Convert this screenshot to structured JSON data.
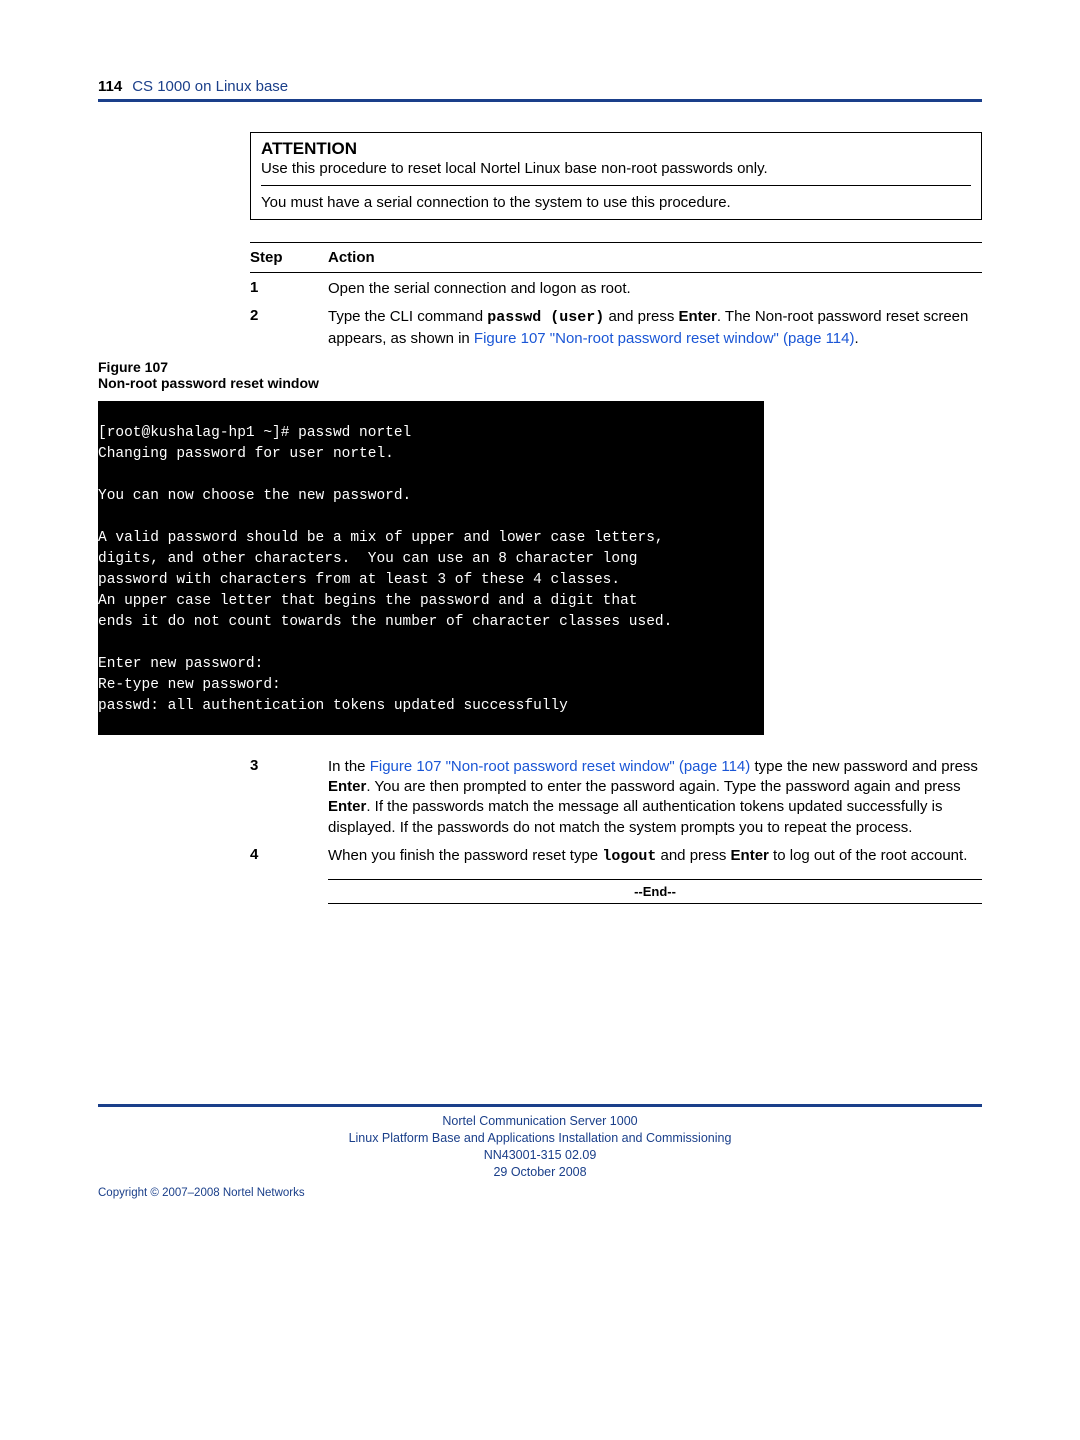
{
  "header": {
    "page_number": "114",
    "section": "CS 1000 on Linux base"
  },
  "attention": {
    "heading": "ATTENTION",
    "line1": "Use this procedure to reset local Nortel Linux base non-root passwords only.",
    "line2": "You must have a serial connection to the system to use this procedure."
  },
  "table_head": {
    "step": "Step",
    "action": "Action"
  },
  "steps": {
    "s1": {
      "num": "1",
      "action": "Open the serial connection and logon as root."
    },
    "s2": {
      "num": "2",
      "a1": "Type the CLI command ",
      "cmd": "passwd (user)",
      "a2": " and press ",
      "enter": "Enter",
      "a3": ". The Non-root password reset screen appears, as shown in ",
      "link": "Figure 107 \"Non-root password reset window\" (page 114)",
      "a4": "."
    },
    "s3": {
      "num": "3",
      "a1": "In the ",
      "link": "Figure 107 \"Non-root password reset window\" (page 114)",
      "a2": " type the new password and press ",
      "enter1": "Enter",
      "a3": ". You are then prompted to enter the password again. Type the password again and press ",
      "enter2": "Enter",
      "a4": ". If the passwords match the message all authentication tokens updated successfully is displayed. If the passwords do not match the system prompts you to repeat the process."
    },
    "s4": {
      "num": "4",
      "a1": "When you finish the password reset type ",
      "cmd": "logout",
      "a2": " and press ",
      "enter": "Enter",
      "a3": " to log out of the root account."
    }
  },
  "figure": {
    "label": "Figure 107",
    "title": "Non-root password reset window"
  },
  "terminal": "[root@kushalag-hp1 ~]# passwd nortel\nChanging password for user nortel.\n\nYou can now choose the new password.\n\nA valid password should be a mix of upper and lower case letters,\ndigits, and other characters.  You can use an 8 character long\npassword with characters from at least 3 of these 4 classes.\nAn upper case letter that begins the password and a digit that\nends it do not count towards the number of character classes used.\n\nEnter new password:\nRe-type new password:\npasswd: all authentication tokens updated successfully",
  "end": "--End--",
  "footer": {
    "l1": "Nortel Communication Server 1000",
    "l2": "Linux Platform Base and Applications Installation and Commissioning",
    "l3": "NN43001-315   02.09",
    "l4": "29 October 2008",
    "copyright": "Copyright © 2007–2008 Nortel Networks"
  }
}
